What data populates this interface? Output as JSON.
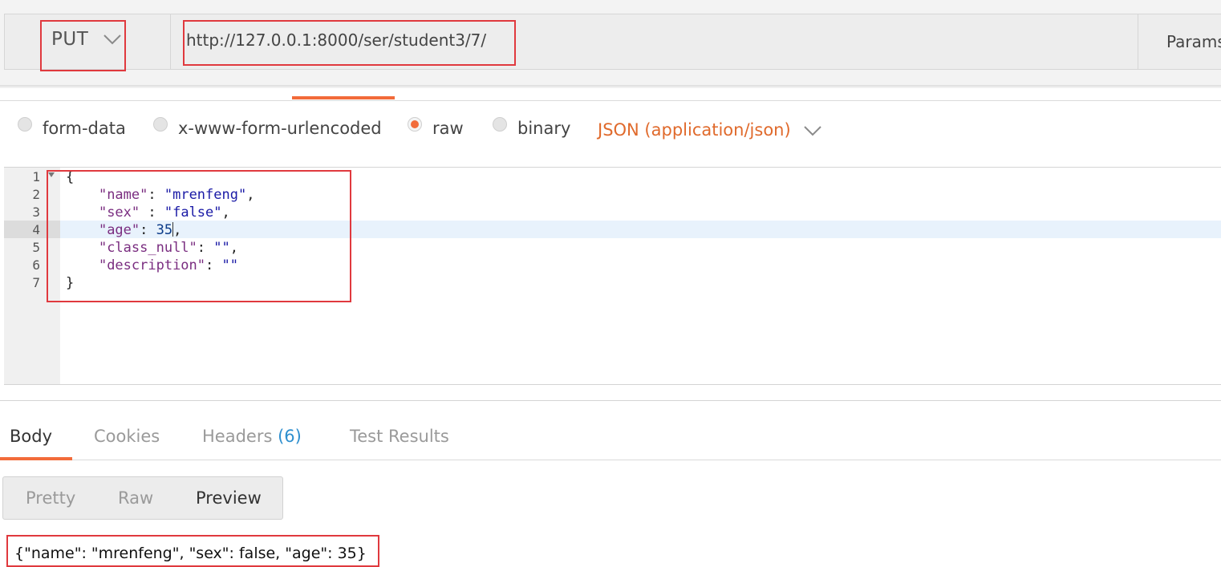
{
  "request": {
    "method": "PUT",
    "url": "http://127.0.0.1:8000/ser/student3/7/",
    "params_label": "Params"
  },
  "body_types": {
    "form_data": "form-data",
    "urlencoded": "x-www-form-urlencoded",
    "raw": "raw",
    "binary": "binary",
    "selected": "raw",
    "content_type": "JSON (application/json)"
  },
  "editor": {
    "line_numbers": [
      "1",
      "2",
      "3",
      "4",
      "5",
      "6",
      "7"
    ],
    "active_line": 4,
    "lines": [
      "{",
      "    \"name\": \"mrenfeng\",",
      "    \"sex\" : \"false\",",
      "    \"age\": 35,",
      "    \"class_null\": \"\",",
      "    \"description\": \"\"",
      "}"
    ]
  },
  "response": {
    "tabs": {
      "body": "Body",
      "cookies": "Cookies",
      "headers": "Headers",
      "headers_count": "(6)",
      "test_results": "Test Results"
    },
    "views": {
      "pretty": "Pretty",
      "raw": "Raw",
      "preview": "Preview",
      "selected": "Preview"
    },
    "preview_text": "{\"name\": \"mrenfeng\", \"sex\": false, \"age\": 35}"
  },
  "colors": {
    "accent": "#f26b3a",
    "highlight_box": "#e0393e",
    "content_type": "#e06a2c",
    "count": "#2e8fcf"
  }
}
